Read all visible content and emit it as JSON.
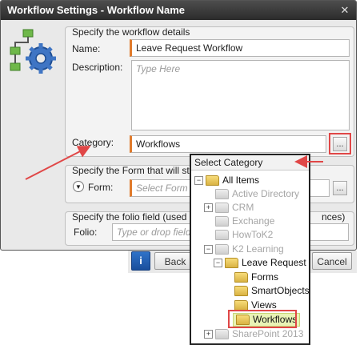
{
  "window": {
    "title": "Workflow Settings - Workflow Name",
    "close_icon": "close-icon",
    "app_icon": "workflow-settings-icon"
  },
  "details": {
    "group_title": "Specify the workflow details",
    "name_label": "Name:",
    "name_value": "Leave Request Workflow",
    "description_label": "Description:",
    "description_placeholder": "Type Here",
    "category_label": "Category:",
    "category_value": "Workflows",
    "browse_label": "..."
  },
  "form": {
    "group_title": "Specify the Form that will st",
    "form_label": "Form:",
    "form_placeholder": "Select Form",
    "browse_label": "...",
    "toggle_icon": "chevron-down-icon"
  },
  "folio": {
    "group_title": "Specify the folio field (used",
    "group_title_tail": "nces)",
    "folio_label": "Folio:",
    "folio_placeholder": "Type or drop field"
  },
  "footer": {
    "info_label": "i",
    "back_label": "Back",
    "cancel_label": "Cancel"
  },
  "category_popup": {
    "header": "Select Category",
    "tree": [
      {
        "label": "All Items",
        "toggle": "−",
        "state": "active"
      },
      {
        "label": "Active Directory",
        "toggle": "",
        "state": "dim"
      },
      {
        "label": "CRM",
        "toggle": "+",
        "state": "dim"
      },
      {
        "label": "Exchange",
        "toggle": "",
        "state": "dim"
      },
      {
        "label": "HowToK2",
        "toggle": "",
        "state": "dim"
      },
      {
        "label": "K2 Learning",
        "toggle": "−",
        "state": "dim"
      },
      {
        "label": "Leave Request",
        "toggle": "−",
        "state": "active"
      },
      {
        "label": "Forms",
        "toggle": "",
        "state": "active"
      },
      {
        "label": "SmartObjects",
        "toggle": "",
        "state": "active"
      },
      {
        "label": "Views",
        "toggle": "",
        "state": "active"
      },
      {
        "label": "Workflows",
        "toggle": "",
        "state": "selected"
      },
      {
        "label": "SharePoint 2013",
        "toggle": "+",
        "state": "dim"
      }
    ]
  },
  "colors": {
    "accent_required": "#e07a2b",
    "annotation_red": "#e04747",
    "selection": "#e9f3b5"
  }
}
